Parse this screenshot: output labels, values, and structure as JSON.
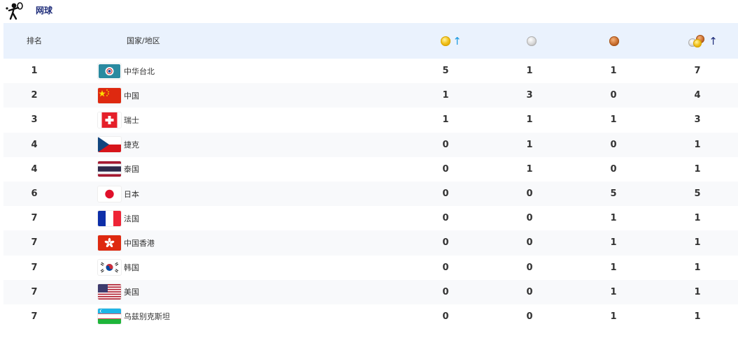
{
  "sport": {
    "title": "网球",
    "icon": "tennis-player-icon"
  },
  "headers": {
    "rank": "排名",
    "country": "国家/地区"
  },
  "colors": {
    "gold": "#f2c21b",
    "silver": "#cfcfcf",
    "bronze": "#c66a2a",
    "header_bg": "#eaf2fd",
    "title": "#1f2d7a",
    "sort_arrow": "#1e9be0"
  },
  "rows": [
    {
      "rank": "1",
      "country": "中华台北",
      "flag": "flag-chinese-taipei-icon",
      "gold": "5",
      "silver": "1",
      "bronze": "1",
      "total": "7"
    },
    {
      "rank": "2",
      "country": "中国",
      "flag": "flag-china-icon",
      "gold": "1",
      "silver": "3",
      "bronze": "0",
      "total": "4"
    },
    {
      "rank": "3",
      "country": "瑞士",
      "flag": "flag-switzerland-icon",
      "gold": "1",
      "silver": "1",
      "bronze": "1",
      "total": "3"
    },
    {
      "rank": "4",
      "country": "捷克",
      "flag": "flag-czech-icon",
      "gold": "0",
      "silver": "1",
      "bronze": "0",
      "total": "1"
    },
    {
      "rank": "4",
      "country": "泰国",
      "flag": "flag-thailand-icon",
      "gold": "0",
      "silver": "1",
      "bronze": "0",
      "total": "1"
    },
    {
      "rank": "6",
      "country": "日本",
      "flag": "flag-japan-icon",
      "gold": "0",
      "silver": "0",
      "bronze": "5",
      "total": "5"
    },
    {
      "rank": "7",
      "country": "法国",
      "flag": "flag-france-icon",
      "gold": "0",
      "silver": "0",
      "bronze": "1",
      "total": "1"
    },
    {
      "rank": "7",
      "country": "中国香港",
      "flag": "flag-hong-kong-icon",
      "gold": "0",
      "silver": "0",
      "bronze": "1",
      "total": "1"
    },
    {
      "rank": "7",
      "country": "韩国",
      "flag": "flag-korea-icon",
      "gold": "0",
      "silver": "0",
      "bronze": "1",
      "total": "1"
    },
    {
      "rank": "7",
      "country": "美国",
      "flag": "flag-usa-icon",
      "gold": "0",
      "silver": "0",
      "bronze": "1",
      "total": "1"
    },
    {
      "rank": "7",
      "country": "乌兹别克斯坦",
      "flag": "flag-uzbekistan-icon",
      "gold": "0",
      "silver": "0",
      "bronze": "1",
      "total": "1"
    }
  ]
}
